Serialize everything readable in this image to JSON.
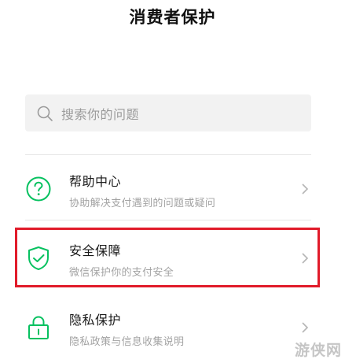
{
  "page": {
    "title": "消费者保护"
  },
  "search": {
    "placeholder": "搜索你的问题"
  },
  "items": [
    {
      "label": "帮助中心",
      "desc": "协助解决支付遇到的问题或疑问",
      "icon": "help-circle-icon"
    },
    {
      "label": "安全保障",
      "desc": "微信保护你的支付安全",
      "icon": "shield-check-icon"
    },
    {
      "label": "隐私保护",
      "desc": "隐私政策与信息收集说明",
      "icon": "lock-icon"
    }
  ],
  "colors": {
    "accent": "#07c160",
    "highlight": "#e11b2a"
  },
  "watermark": "游侠网"
}
